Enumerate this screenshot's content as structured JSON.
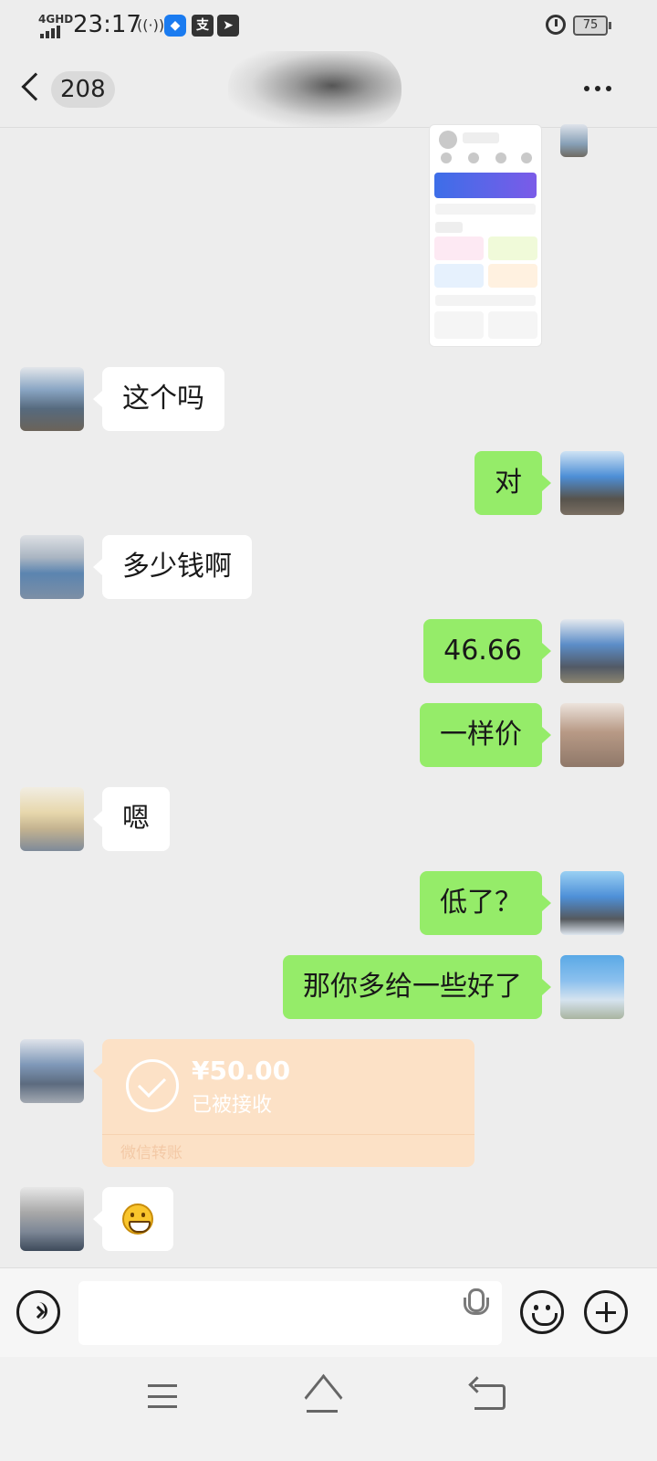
{
  "status_bar": {
    "network": "4GHD",
    "time": "23:17",
    "pay_label": "支",
    "battery": "75"
  },
  "header": {
    "unread_count": "208"
  },
  "messages": {
    "m1": "这个吗",
    "m2": "对",
    "m3": "多少钱啊",
    "m4": "46.66",
    "m5": "一样价",
    "m6": "嗯",
    "m7": "低了？",
    "m8": "那你多给一些好了"
  },
  "transfer": {
    "amount": "¥50.00",
    "status": "已被接收",
    "label": "微信转账"
  },
  "colors": {
    "background": "#ededed",
    "bubble_out": "#95ec69",
    "bubble_in": "#ffffff",
    "transfer_card": "#fce1c6"
  }
}
